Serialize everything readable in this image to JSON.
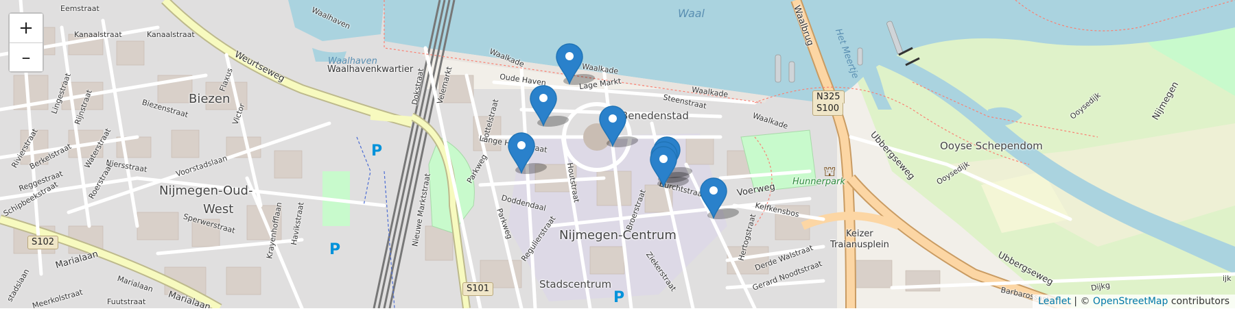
{
  "zoom": {
    "in_label": "+",
    "out_label": "–"
  },
  "attribution": {
    "leaflet": "Leaflet",
    "separator": " | © ",
    "osm": "OpenStreetMap",
    "suffix": " contributors"
  },
  "places": {
    "biezen": "Biezen",
    "oud_west_1": "Nijmegen-Oud-",
    "oud_west_2": "West",
    "centrum": "Nijmegen-Centrum",
    "stadscentrum": "Stadscentrum",
    "benedenstad": "Benedenstad",
    "waalhavenkwartier": "Waalhavenkwartier",
    "ooyse": "Ooyse Schependom",
    "keizer_1": "Keizer",
    "keizer_2": "Traianusplein",
    "hunnerpark": "Hunnerpark"
  },
  "water": {
    "waal": "Waal",
    "waalhaven": "Waalhaven",
    "meertje": "Het Meertje"
  },
  "streets": {
    "eemstraat": "Eemstraat",
    "waalhaven_st": "Waalhaven",
    "kanaalstraat_a": "Kanaalstraat",
    "kanaalstraat_b": "Kanaalstraat",
    "weurtseweg": "Weurtseweg",
    "flaxus": "Flaxus",
    "lingestraat": "Lingestraat",
    "rijnstraat": "Rijnstraat",
    "biezenstraat": "Biezenstraat",
    "victor": "Victor",
    "rivierstraat": "Rivierstraat",
    "berkelstraat": "Berkelstraat",
    "waterstraat": "Waterstraat",
    "niersstraat": "Niersstraat",
    "reggestraat": "Reggestraat",
    "roerstraat": "Roerstraat",
    "voorstadslaan": "Voorstadslaan",
    "schipbeekstraat": "Schipbeekstraat",
    "sperwerstraat": "Sperwerstraat",
    "havikstraat": "Havikstraat",
    "krayenhofflaan": "Krayenhofflaan",
    "marialaan_a": "Marialaan",
    "marialaan_b": "Marialaan",
    "marialaan_c": "Marialaan",
    "meerkolstraat": "Meerkolstraat",
    "fuutstraat": "Fuutstraat",
    "stadslaan": "stadslaan",
    "dokstraat": "Dokstraat",
    "nieuwe_markt": "Nieuwe Marktstraat",
    "waalkade_a": "Waalkade",
    "waalkade_b": "Waalkade",
    "waalkade_c": "Waalkade",
    "waalkade_d": "Waalkade",
    "velemarkt": "Velemarkt",
    "oude_haven": "Oude Haven",
    "lage_markt": "Lage Markt",
    "bottelstraat": "Bottelstraat",
    "steenstraat": "Steenstraat",
    "lange_hezel": "Lange Hezelstraat",
    "parkweg_a": "Parkweg",
    "parkweg_b": "Parkweg",
    "doddendaal": "Doddendaal",
    "houtstraat": "Houtstraat",
    "regulierstraat": "Regulierstraat",
    "broerstraat": "Broerstraat",
    "burchtstraat": "Burchtstraat",
    "ziekerstraat": "Ziekerstraat",
    "voerweg": "Voerweg",
    "kelfkensbos": "Kelfkensbos",
    "hertogstraat": "Hertogstraat",
    "derde_walstraat": "Derde Walstraat",
    "gerard_noodt": "Gerard Noodtstraat",
    "waalbrug": "Waalbrug",
    "ubbergseweg_a": "Ubbergseweg",
    "ubbergseweg_b": "Ubbergseweg",
    "ooysedijk_a": "Ooysedijk",
    "ooysedijk_b": "Ooysedijk",
    "nijmegen_road": "Nijmegen",
    "dijk": "Dijkg",
    "barbarossa": "Barbarossast",
    "ijk": "ijk"
  },
  "route_shields": {
    "s102": "S102",
    "s101": "S101",
    "n325": "N325",
    "s100": "S100"
  },
  "parking_symbol": "P",
  "markers": [
    {
      "name": "marker-1"
    },
    {
      "name": "marker-2"
    },
    {
      "name": "marker-3"
    },
    {
      "name": "marker-4"
    },
    {
      "name": "marker-5"
    },
    {
      "name": "marker-6"
    },
    {
      "name": "marker-7"
    },
    {
      "name": "marker-8"
    }
  ],
  "colors": {
    "water": "#aad3df",
    "park": "#c8facc",
    "building": "#d9d0c9",
    "road": "#ffffff",
    "primary": "#fcd6a4",
    "secondary": "#f7fabf",
    "marker": "#2a81cb"
  }
}
